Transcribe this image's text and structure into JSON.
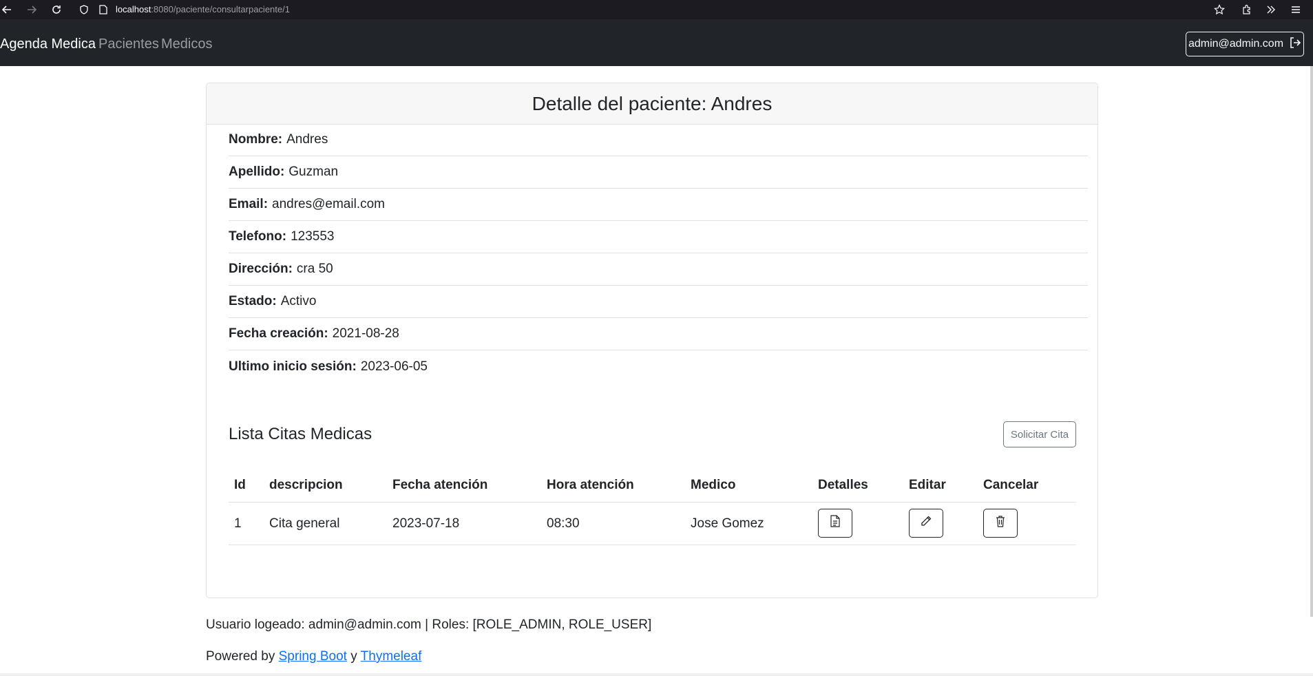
{
  "browser": {
    "url_host": "localhost",
    "url_path": ":8080/paciente/consultarpaciente/1"
  },
  "navbar": {
    "brand": "Agenda Medica",
    "links": [
      "Pacientes",
      "Medicos"
    ],
    "user_button": "admin@admin.com"
  },
  "card": {
    "title": "Detalle del paciente: Andres",
    "details": [
      {
        "label": "Nombre:",
        "value": "Andres"
      },
      {
        "label": "Apellido:",
        "value": "Guzman"
      },
      {
        "label": "Email:",
        "value": "andres@email.com"
      },
      {
        "label": "Telefono:",
        "value": "123553"
      },
      {
        "label": "Dirección:",
        "value": "cra 50"
      },
      {
        "label": "Estado:",
        "value": "Activo"
      },
      {
        "label": "Fecha creación:",
        "value": "2021-08-28"
      },
      {
        "label": "Ultimo inicio sesión:",
        "value": "2023-06-05"
      }
    ]
  },
  "citas": {
    "title": "Lista Citas Medicas",
    "solicitar_label": "Solicitar Cita",
    "headers": [
      "Id",
      "descripcion",
      "Fecha atención",
      "Hora atención",
      "Medico",
      "Detalles",
      "Editar",
      "Cancelar"
    ],
    "rows": [
      {
        "id": "1",
        "descripcion": "Cita general",
        "fecha": "2023-07-18",
        "hora": "08:30",
        "medico": "Jose Gomez"
      }
    ]
  },
  "footer": {
    "user_text": "Usuario logeado: admin@admin.com | Roles: [ROLE_ADMIN, ROLE_USER]",
    "powered_prefix": "Powered by",
    "link1": "Spring Boot",
    "separator": "y",
    "link2": "Thymeleaf"
  },
  "icons": {
    "back": "arrow-left-icon",
    "forward": "arrow-right-icon",
    "reload": "reload-icon",
    "logout": "logout-icon",
    "detalles": "document-icon",
    "editar": "pencil-icon",
    "cancelar": "trash-icon"
  }
}
